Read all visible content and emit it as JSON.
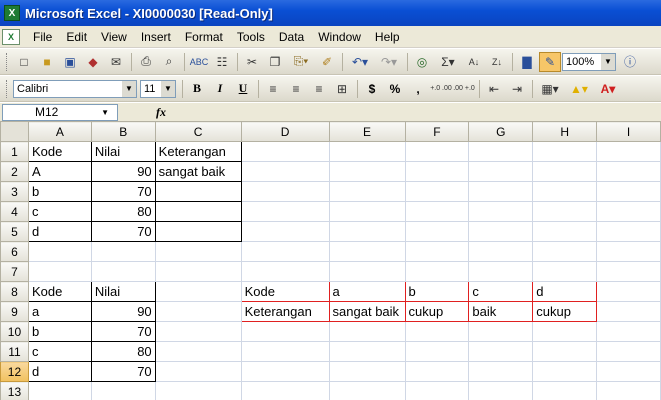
{
  "window": {
    "title": "Microsoft Excel - XI0000030  [Read-Only]",
    "app_icon": "excel-logo"
  },
  "menu": [
    "File",
    "Edit",
    "View",
    "Insert",
    "Format",
    "Tools",
    "Data",
    "Window",
    "Help"
  ],
  "toolbar": {
    "zoom": "100%"
  },
  "format_toolbar": {
    "font": "Calibri",
    "size": "11",
    "bold": "B",
    "italic": "I",
    "underline": "U",
    "currency": "$",
    "percent": "%",
    "comma": ",",
    "inc_dec": "+.0 .00",
    "dec_dec": ".00 +.0"
  },
  "formula_bar": {
    "name_box": "M12",
    "fx": "fx",
    "content": ""
  },
  "sheet": {
    "columns": [
      "A",
      "B",
      "C",
      "D",
      "E",
      "F",
      "G",
      "H",
      "I"
    ],
    "rows": [
      {
        "n": "1",
        "cells": [
          "Kode",
          "Nilai",
          "Keterangan",
          "",
          "",
          "",
          "",
          "",
          ""
        ]
      },
      {
        "n": "2",
        "cells": [
          "A",
          "90",
          "sangat baik",
          "",
          "",
          "",
          "",
          "",
          ""
        ]
      },
      {
        "n": "3",
        "cells": [
          "b",
          "70",
          "",
          "",
          "",
          "",
          "",
          "",
          ""
        ]
      },
      {
        "n": "4",
        "cells": [
          "c",
          "80",
          "",
          "",
          "",
          "",
          "",
          "",
          ""
        ]
      },
      {
        "n": "5",
        "cells": [
          "d",
          "70",
          "",
          "",
          "",
          "",
          "",
          "",
          ""
        ]
      },
      {
        "n": "6",
        "cells": [
          "",
          "",
          "",
          "",
          "",
          "",
          "",
          "",
          ""
        ]
      },
      {
        "n": "7",
        "cells": [
          "",
          "",
          "",
          "",
          "",
          "",
          "",
          "",
          ""
        ]
      },
      {
        "n": "8",
        "cells": [
          "Kode",
          "Nilai",
          "",
          "Kode",
          "a",
          "b",
          "c",
          "d",
          ""
        ]
      },
      {
        "n": "9",
        "cells": [
          "a",
          "90",
          "",
          "Keterangan",
          "sangat baik",
          "cukup",
          "baik",
          "cukup",
          ""
        ]
      },
      {
        "n": "10",
        "cells": [
          "b",
          "70",
          "",
          "",
          "",
          "",
          "",
          "",
          ""
        ]
      },
      {
        "n": "11",
        "cells": [
          "c",
          "80",
          "",
          "",
          "",
          "",
          "",
          "",
          ""
        ]
      },
      {
        "n": "12",
        "cells": [
          "d",
          "70",
          "",
          "",
          "",
          "",
          "",
          "",
          ""
        ]
      },
      {
        "n": "13",
        "cells": [
          "",
          "",
          "",
          "",
          "",
          "",
          "",
          "",
          ""
        ]
      }
    ],
    "selected_row": "12",
    "colors": {
      "selected_header": "#f1c15f",
      "table_border": "#000000",
      "highlight_border": "#e02020",
      "gridline": "#d0d7e5"
    }
  }
}
